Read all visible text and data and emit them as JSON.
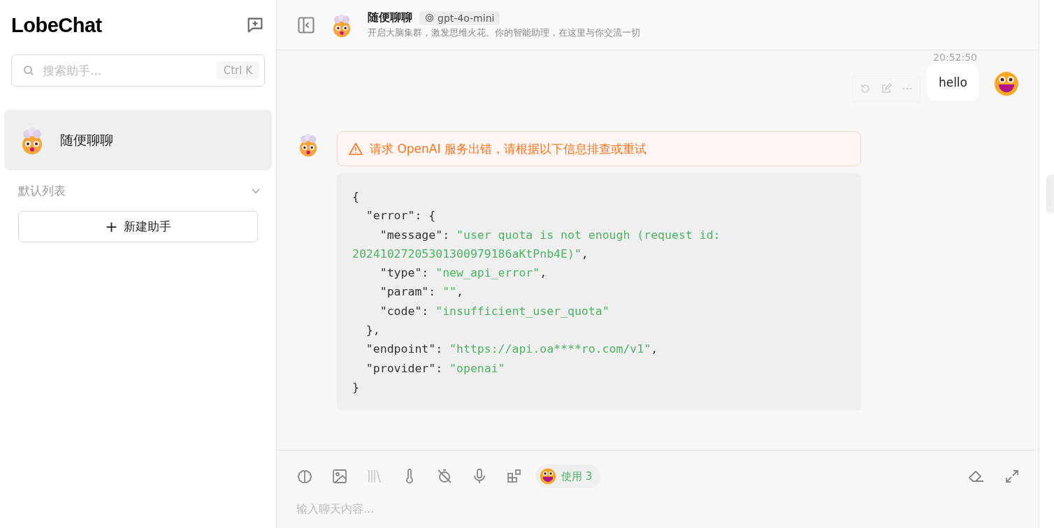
{
  "sidebar": {
    "logo": "LobeChat",
    "search": {
      "placeholder": "搜索助手...",
      "shortcut": "Ctrl K"
    },
    "sessions": [
      {
        "title": "随便聊聊",
        "selected": true
      }
    ],
    "group": {
      "label": "默认列表",
      "expanded": true
    },
    "new_button": {
      "icon": "+",
      "label": "新建助手"
    }
  },
  "header": {
    "title": "随便聊聊",
    "model": "gpt-4o-mini",
    "description": "开启大脑集群，激发思维火花。你的智能助理，在这里与你交流一切"
  },
  "messages": [
    {
      "kind": "user",
      "time": "20:52:50",
      "text": "hello"
    },
    {
      "kind": "error",
      "alert": "请求 OpenAI 服务出错，请根据以下信息排查或重试",
      "code_lines": [
        [
          {
            "kind": "plain",
            "s": "{"
          }
        ],
        [
          {
            "kind": "plain",
            "s": "  \"error\": {"
          }
        ],
        [
          {
            "kind": "plain",
            "s": "    \"message\": "
          },
          {
            "kind": "string",
            "s": "\"user quota is not enough (request id:"
          }
        ],
        [
          {
            "kind": "string",
            "s": "20241027205301300979186aKtPnb4E)\""
          },
          {
            "kind": "plain",
            "s": ","
          }
        ],
        [
          {
            "kind": "plain",
            "s": "    \"type\": "
          },
          {
            "kind": "string",
            "s": "\"new_api_error\""
          },
          {
            "kind": "plain",
            "s": ","
          }
        ],
        [
          {
            "kind": "plain",
            "s": "    \"param\": "
          },
          {
            "kind": "string",
            "s": "\"\""
          },
          {
            "kind": "plain",
            "s": ","
          }
        ],
        [
          {
            "kind": "plain",
            "s": "    \"code\": "
          },
          {
            "kind": "string",
            "s": "\"insufficient_user_quota\""
          }
        ],
        [
          {
            "kind": "plain",
            "s": "  },"
          }
        ],
        [
          {
            "kind": "plain",
            "s": "  \"endpoint\": "
          },
          {
            "kind": "string",
            "s": "\"https://api.oa****ro.com/v1\""
          },
          {
            "kind": "plain",
            "s": ","
          }
        ],
        [
          {
            "kind": "plain",
            "s": "  \"provider\": "
          },
          {
            "kind": "string",
            "s": "\"openai\""
          }
        ],
        [
          {
            "kind": "plain",
            "s": "}"
          }
        ]
      ]
    }
  ],
  "input": {
    "tools": [
      {
        "kind": "brain",
        "disabled": false
      },
      {
        "kind": "image",
        "disabled": false
      },
      {
        "kind": "library",
        "disabled": true
      },
      {
        "kind": "thermometer",
        "disabled": false
      },
      {
        "kind": "timer-off",
        "disabled": false
      },
      {
        "kind": "microphone",
        "disabled": false
      },
      {
        "kind": "apps",
        "disabled": false
      }
    ],
    "usage": "使用 3",
    "placeholder": "输入聊天内容..."
  }
}
